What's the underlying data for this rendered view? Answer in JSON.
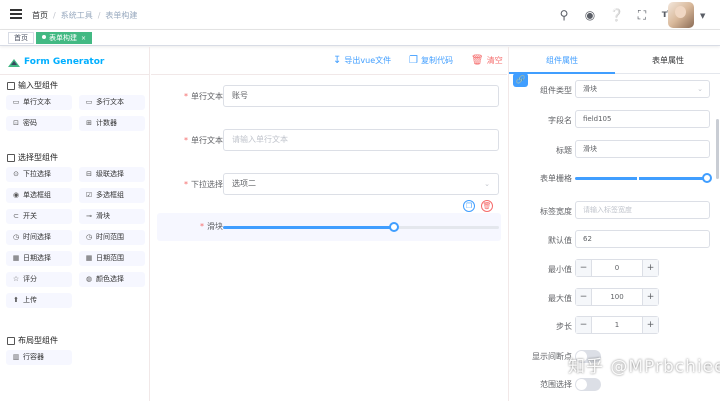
{
  "navbar": {
    "breadcrumbs": [
      "首页",
      "系统工具",
      "表单构建"
    ],
    "separator": "/"
  },
  "tags": [
    {
      "label": "首页",
      "active": false
    },
    {
      "label": "表单构建",
      "active": true,
      "close": "×"
    }
  ],
  "left_panel": {
    "logo_text": "Form Generator",
    "groups": [
      {
        "title": "输入型组件",
        "items": [
          {
            "label": "单行文本",
            "icon": "▭"
          },
          {
            "label": "多行文本",
            "icon": "▭"
          },
          {
            "label": "密码",
            "icon": "⊡"
          },
          {
            "label": "计数器",
            "icon": "⊞"
          }
        ]
      },
      {
        "title": "选择型组件",
        "items": [
          {
            "label": "下拉选择",
            "icon": "⊙"
          },
          {
            "label": "级联选择",
            "icon": "⊟"
          },
          {
            "label": "单选框组",
            "icon": "◉"
          },
          {
            "label": "多选框组",
            "icon": "☑"
          },
          {
            "label": "开关",
            "icon": "⊂"
          },
          {
            "label": "滑块",
            "icon": "⊸"
          },
          {
            "label": "时间选择",
            "icon": "◷"
          },
          {
            "label": "时间范围",
            "icon": "◷"
          },
          {
            "label": "日期选择",
            "icon": "▦"
          },
          {
            "label": "日期范围",
            "icon": "▦"
          },
          {
            "label": "评分",
            "icon": "☆"
          },
          {
            "label": "颜色选择",
            "icon": "◍"
          },
          {
            "label": "上传",
            "icon": "⬆"
          }
        ]
      },
      {
        "title": "布局型组件",
        "items": [
          {
            "label": "行容器",
            "icon": "▥"
          }
        ]
      }
    ]
  },
  "toolbar": {
    "export_label": "导出vue文件",
    "copy_label": "复制代码",
    "clear_label": "清空"
  },
  "canvas": {
    "rows": [
      {
        "label": "单行文本",
        "type": "input",
        "value": "账号",
        "placeholder": ""
      },
      {
        "label": "单行文本",
        "type": "input",
        "value": "",
        "placeholder": "请输入单行文本"
      },
      {
        "label": "下拉选择",
        "type": "select",
        "value": "选项二",
        "placeholder": ""
      },
      {
        "label": "滑块",
        "type": "slider",
        "value": 62,
        "min": 0,
        "max": 100
      }
    ]
  },
  "right_panel": {
    "tab_component": "组件属性",
    "tab_form": "表单属性",
    "fields": {
      "component_type_label": "组件类型",
      "component_type_value": "滑块",
      "field_name_label": "字段名",
      "field_name_value": "field105",
      "title_label": "标题",
      "title_value": "滑块",
      "grid_label": "表单栅格",
      "grid_value": 24,
      "grid_max": 24,
      "label_width_label": "标签宽度",
      "label_width_placeholder": "请输入标签宽度",
      "default_label": "默认值",
      "default_value": "62",
      "min_label": "最小值",
      "min_value": "0",
      "max_label": "最大值",
      "max_value": "100",
      "step_label": "步长",
      "step_value": "1",
      "show_stops_label": "显示间断点",
      "range_label": "范围选择"
    }
  },
  "watermark": "知乎 @MPrbchieer"
}
